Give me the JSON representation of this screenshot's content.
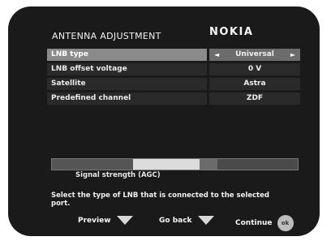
{
  "screen": {
    "title": "ANTENNA ADJUSTMENT",
    "brand": "NOKIA"
  },
  "menu": {
    "rows": [
      {
        "label": "LNB type",
        "value": "Universal",
        "selected": true
      },
      {
        "label": "LNB offset voltage",
        "value": "0 V",
        "selected": false
      },
      {
        "label": "Satellite",
        "value": "Astra",
        "selected": false
      },
      {
        "label": "Predefined channel",
        "value": "ZDF",
        "selected": false
      }
    ]
  },
  "signal": {
    "label": "Signal strength (AGC)",
    "level_fraction": 0.6
  },
  "help_text": "Select the type of LNB that is connected to the selected port.",
  "footer": {
    "preview": "Preview",
    "goback": "Go back",
    "continue": "Continue",
    "ok": "ok"
  },
  "icons": {
    "left_arrow": "◄",
    "right_arrow": "►"
  }
}
